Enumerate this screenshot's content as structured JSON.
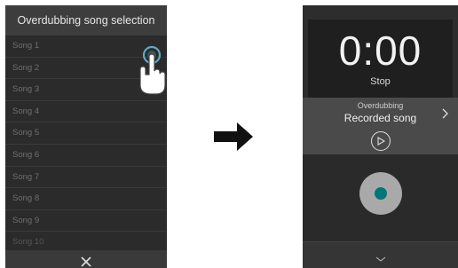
{
  "left_screen": {
    "title": "Overdubbing song selection",
    "songs": [
      "Song 1",
      "Song 2",
      "Song 3",
      "Song 4",
      "Song 5",
      "Song 6",
      "Song 7",
      "Song 8",
      "Song 9",
      "Song 10"
    ],
    "close_icon": "close-icon"
  },
  "arrow_icon": "arrow-right-icon",
  "right_screen": {
    "timer": "0:00",
    "state": "Stop",
    "mode_label": "Overdubbing",
    "song_label": "Recorded song",
    "record_color": "#00757a"
  }
}
